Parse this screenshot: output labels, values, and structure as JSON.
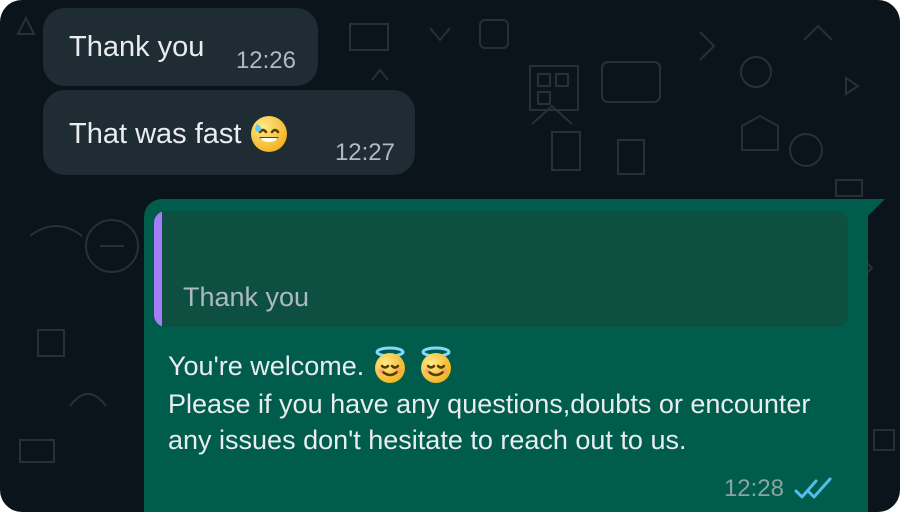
{
  "theme": {
    "background": "#0b141a",
    "incoming_bubble": "#202c33",
    "outgoing_bubble": "#005c4b",
    "quote_bubble": "#0d4f40",
    "quote_accent": "#a67cf8",
    "text_primary": "#e9edef",
    "text_secondary": "#aebac1",
    "read_receipt": "#53bdeb"
  },
  "messages": {
    "m1": {
      "text": "Thank you",
      "time": "12:26"
    },
    "m2": {
      "text": "That was fast",
      "time": "12:27",
      "emoji": "grinning-face-with-sweat-icon"
    },
    "m3": {
      "quote": "Thank you",
      "line1": "You're welcome.",
      "line2": "Please if you have any questions,doubts or encounter any issues don't hesitate to reach out to us.",
      "time": "12:28",
      "status": "read-receipts-icon",
      "emojis": [
        "smiling-face-with-halo-icon",
        "smiling-face-with-halo-icon"
      ]
    }
  }
}
